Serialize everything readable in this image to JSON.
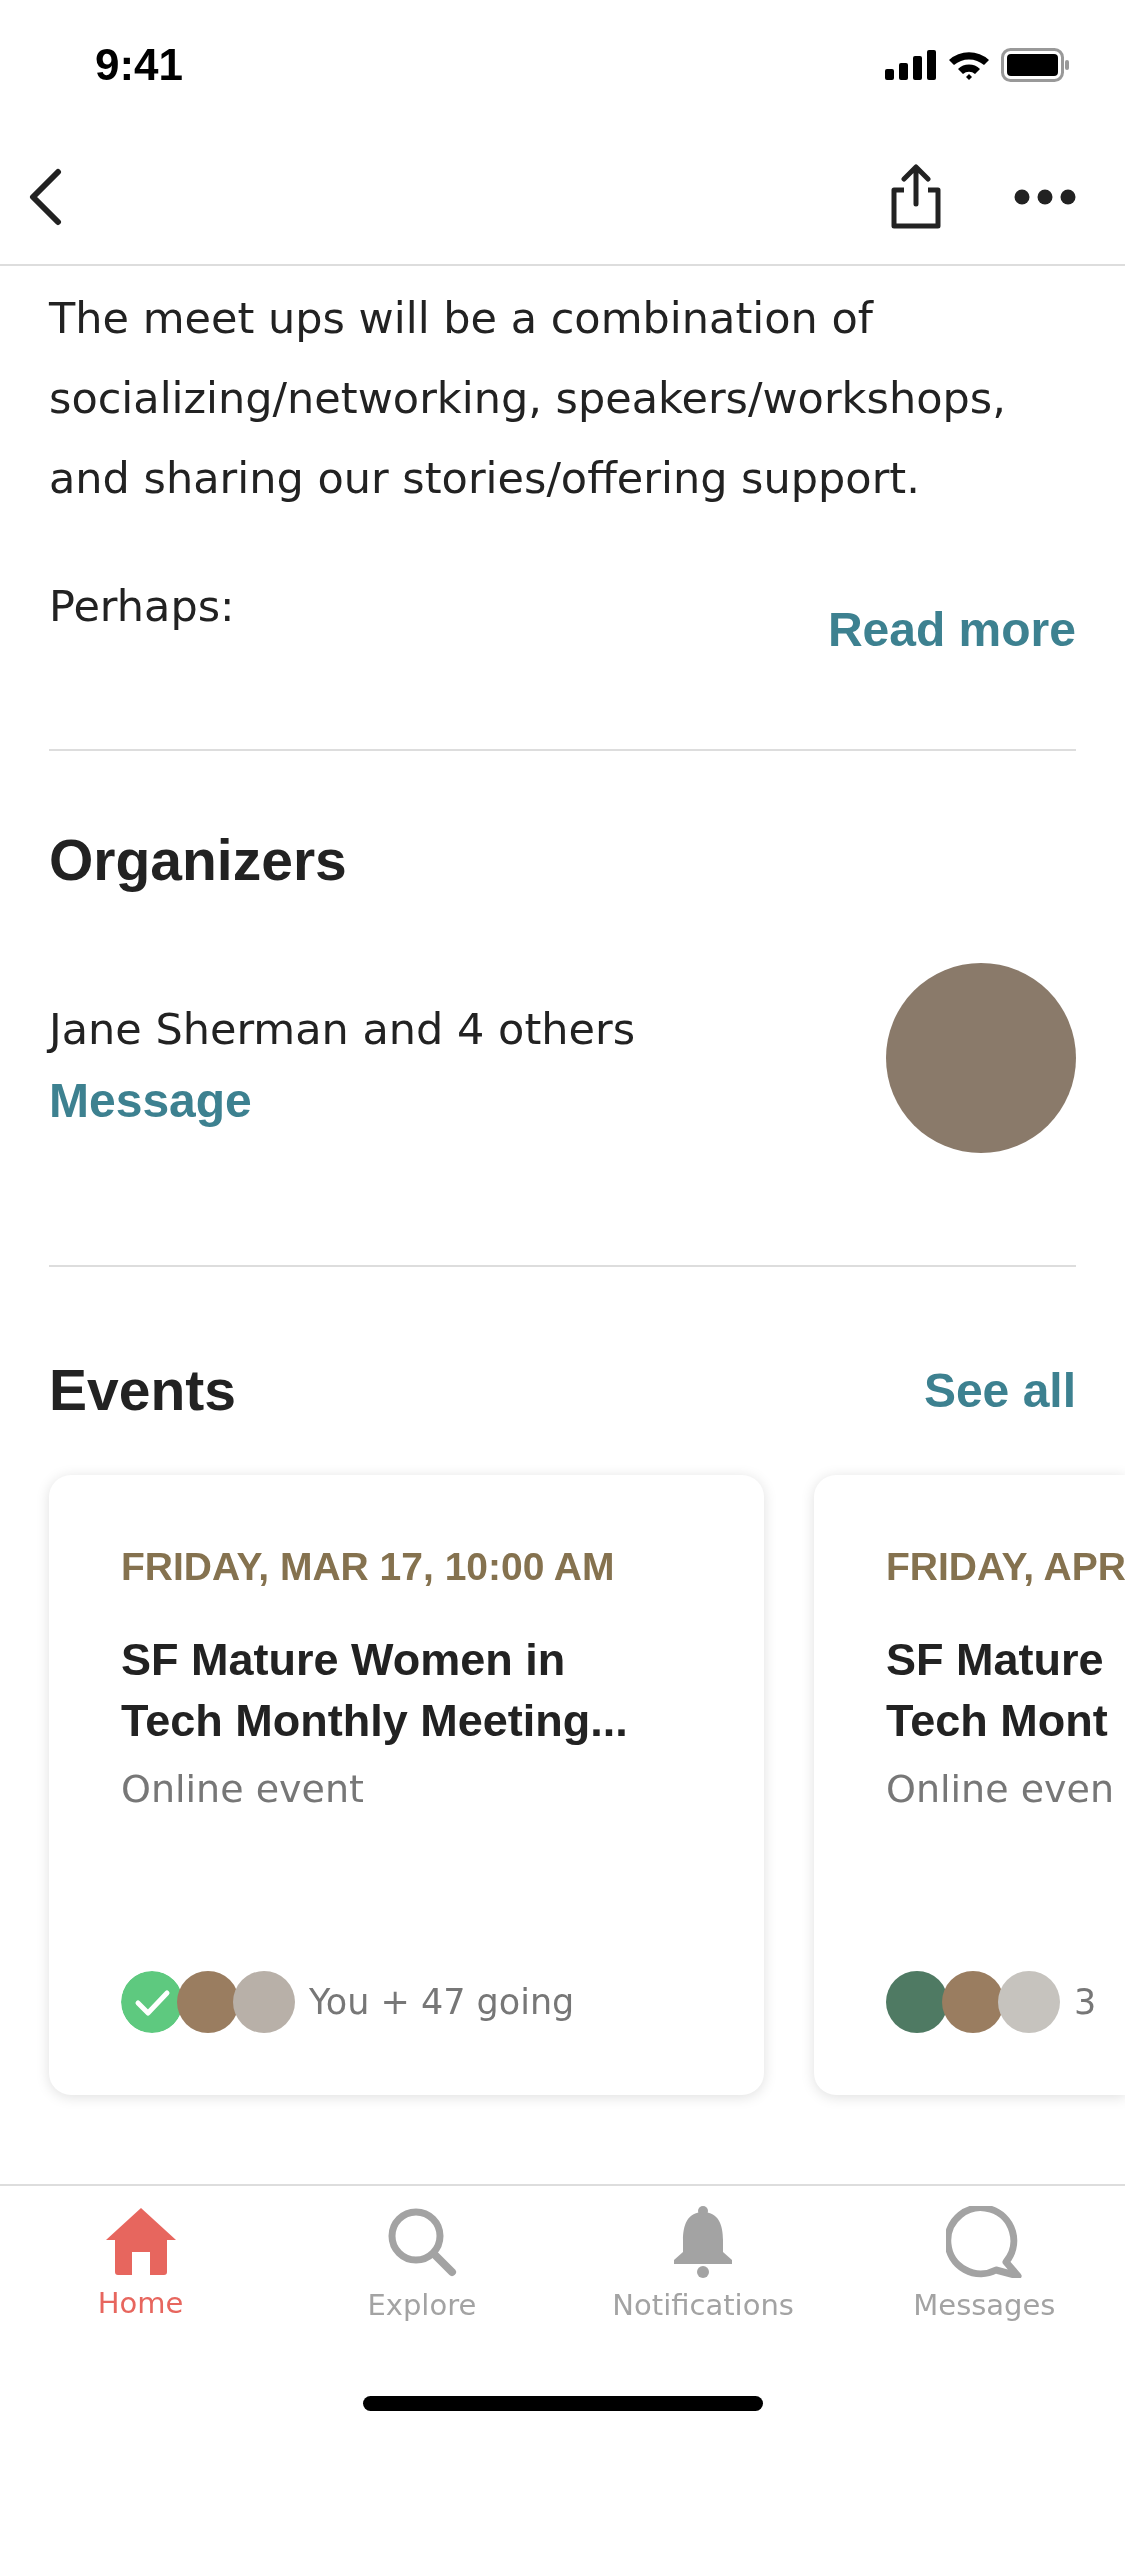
{
  "status_bar": {
    "time": "9:41"
  },
  "about": {
    "paragraph": "The meet ups will be a combination of socializing/networking, speakers/workshops, and sharing our stories/offering support.",
    "paragraph_2": "Perhaps:",
    "read_more": "Read more"
  },
  "organizers": {
    "heading": "Organizers",
    "names": "Jane Sherman and 4 others",
    "message": "Message"
  },
  "events": {
    "heading": "Events",
    "see_all": "See all",
    "cards": [
      {
        "date": "FRIDAY, MAR 17, 10:00 AM",
        "title_lines": [
          "SF Mature Women in",
          "Tech Monthly Meeting..."
        ],
        "location": "Online event",
        "attending": true,
        "going": "You + 47 going"
      },
      {
        "date": "FRIDAY, APR",
        "title_lines": [
          "SF Mature",
          "Tech Mont"
        ],
        "location": "Online even",
        "attending": false,
        "going": "3"
      }
    ]
  },
  "tab_bar": [
    {
      "label": "Home",
      "kind": "home",
      "selected": true
    },
    {
      "label": "Explore",
      "kind": "search",
      "selected": false
    },
    {
      "label": "Notifications",
      "kind": "bell",
      "selected": false
    },
    {
      "label": "Messages",
      "kind": "chat",
      "selected": false
    }
  ]
}
